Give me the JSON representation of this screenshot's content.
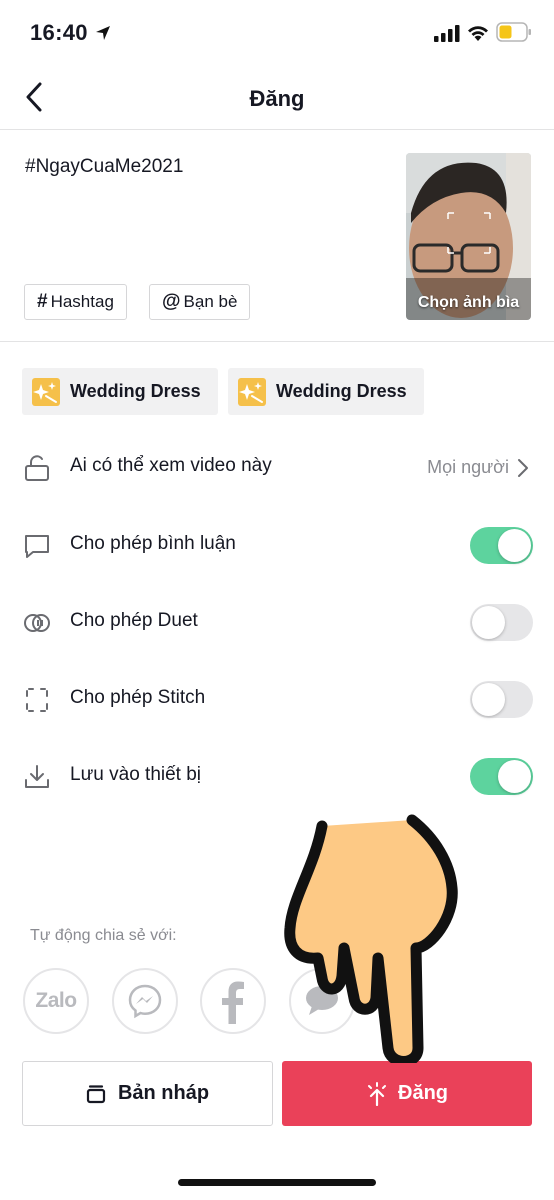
{
  "status_bar": {
    "time": "16:40"
  },
  "nav": {
    "title": "Đăng"
  },
  "post": {
    "caption": "#NgayCuaMe2021",
    "hashtag_chip": "Hashtag",
    "friends_chip": "Bạn bè",
    "cover_label": "Chọn ảnh bìa"
  },
  "effects": [
    {
      "label": "Wedding Dress",
      "icon": "sparkle-star-icon"
    },
    {
      "label": "Wedding Dress",
      "icon": "sparkle-star-icon"
    }
  ],
  "settings": [
    {
      "label": "Ai có thể xem video này",
      "value": "Mọi người",
      "icon": "lock-icon"
    },
    {
      "label": "Cho phép bình luận",
      "enabled": true,
      "icon": "comment-icon"
    },
    {
      "label": "Cho phép Duet",
      "enabled": false,
      "icon": "duet-icon"
    },
    {
      "label": "Cho phép Stitch",
      "enabled": false,
      "icon": "stitch-icon"
    },
    {
      "label": "Lưu vào thiết bị",
      "enabled": true,
      "icon": "download-icon"
    }
  ],
  "share": {
    "label": "Tự động chia sẻ với:",
    "targets": [
      {
        "name": "Zalo",
        "icon": "zalo-icon"
      },
      {
        "name": "Messenger",
        "icon": "messenger-icon"
      },
      {
        "name": "Facebook",
        "icon": "facebook-icon"
      },
      {
        "name": "SMS",
        "icon": "message-bubble-icon"
      }
    ]
  },
  "buttons": {
    "draft": "Bản nháp",
    "post": "Đăng"
  },
  "colors": {
    "accent": "#ea4159",
    "toggle_on": "#5dd39e",
    "effect_icon": "#f5c04a"
  }
}
